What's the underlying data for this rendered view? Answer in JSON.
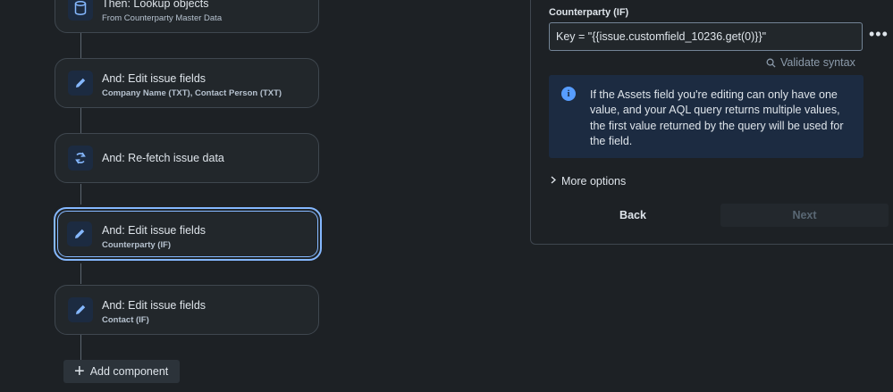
{
  "flow": {
    "cards": [
      {
        "title": "Then: Lookup objects",
        "subtitle": "From Counterparty Master Data",
        "icon": "database-icon"
      },
      {
        "title": "And: Edit issue fields",
        "subtitle": "Company Name (TXT), Contact Person (TXT)",
        "icon": "pencil-icon"
      },
      {
        "title": "And: Re-fetch issue data",
        "subtitle": "",
        "icon": "refresh-icon"
      },
      {
        "title": "And: Edit issue fields",
        "subtitle": "Counterparty (IF)",
        "icon": "pencil-icon",
        "selected": true
      },
      {
        "title": "And: Edit issue fields",
        "subtitle": "Contact (IF)",
        "icon": "pencil-icon"
      }
    ],
    "add_component_label": "Add component"
  },
  "panel": {
    "field_label": "Counterparty (IF)",
    "field_value": "Key = \"{{issue.customfield_10236.get(0)}}\"",
    "more_menu_label": "•••",
    "validate_label": "Validate syntax",
    "info_text": "If the Assets field you're editing can only have one value, and your AQL query returns multiple values, the first value returned by the query will be used for the field.",
    "more_options_label": "More options",
    "back_label": "Back",
    "next_label": "Next"
  },
  "colors": {
    "background": "#1d2125",
    "card": "#22272b",
    "accent": "#85b8ff",
    "info_bg": "#1c2b41",
    "info_icon": "#579dff"
  }
}
